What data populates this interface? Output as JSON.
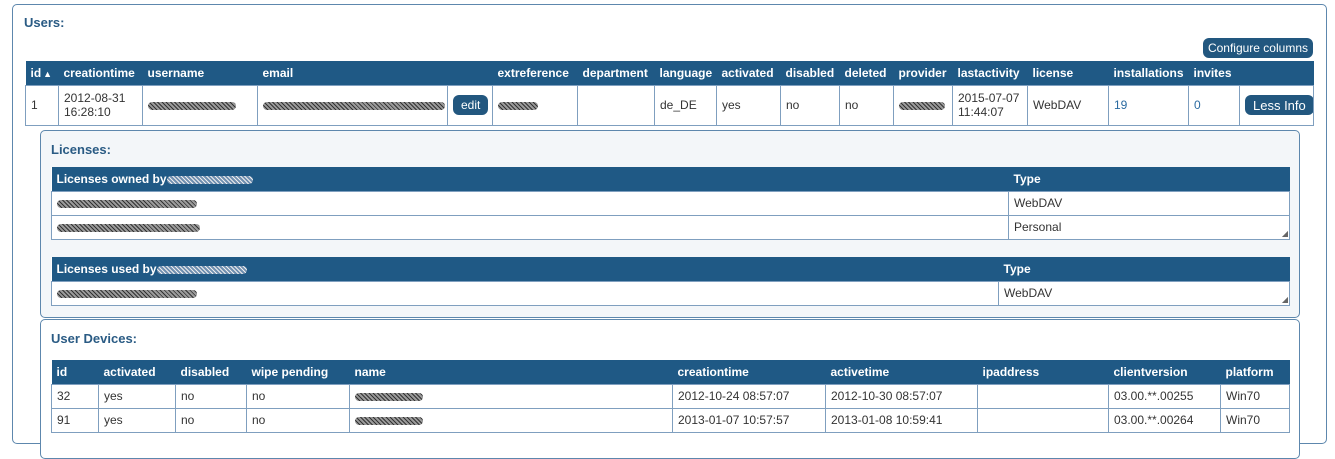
{
  "users": {
    "title": "Users:",
    "configure_label": "Configure columns",
    "sort_indicator": "▲",
    "columns": [
      "id",
      "creationtime",
      "username",
      "email",
      "",
      "extreference",
      "department",
      "language",
      "activated",
      "disabled",
      "deleted",
      "provider",
      "lastactivity",
      "license",
      "installations",
      "invites",
      ""
    ],
    "row": {
      "id": "1",
      "creationtime_date": "2012-08-31",
      "creationtime_time": "16:28:10",
      "edit_label": "edit",
      "extreference": "",
      "department": "",
      "language": "de_DE",
      "activated": "yes",
      "disabled": "no",
      "deleted": "no",
      "lastactivity_date": "2015-07-07",
      "lastactivity_time": "11:44:07",
      "license": "WebDAV",
      "installations": "19",
      "invites": "0",
      "less_info_label": "Less Info"
    }
  },
  "licenses": {
    "title": "Licenses:",
    "owned": {
      "header": "Licenses owned by",
      "type_header": "Type",
      "rows": [
        {
          "type": "WebDAV"
        },
        {
          "type": "Personal"
        }
      ]
    },
    "used": {
      "header": "Licenses used by",
      "type_header": "Type",
      "rows": [
        {
          "type": "WebDAV"
        }
      ]
    }
  },
  "devices": {
    "title": "User Devices:",
    "columns": [
      "id",
      "activated",
      "disabled",
      "wipe pending",
      "name",
      "creationtime",
      "activetime",
      "ipaddress",
      "clientversion",
      "platform"
    ],
    "rows": [
      {
        "id": "32",
        "activated": "yes",
        "disabled": "no",
        "wipe_pending": "no",
        "creationtime": "2012-10-24 08:57:07",
        "activetime": "2012-10-30 08:57:07",
        "ipaddress": "",
        "clientversion": "03.00.**.00255",
        "platform": "Win70"
      },
      {
        "id": "91",
        "activated": "yes",
        "disabled": "no",
        "wipe_pending": "no",
        "creationtime": "2013-01-07 10:57:57",
        "activetime": "2013-01-08 10:59:41",
        "ipaddress": "",
        "clientversion": "03.00.**.00264",
        "platform": "Win70"
      }
    ]
  }
}
